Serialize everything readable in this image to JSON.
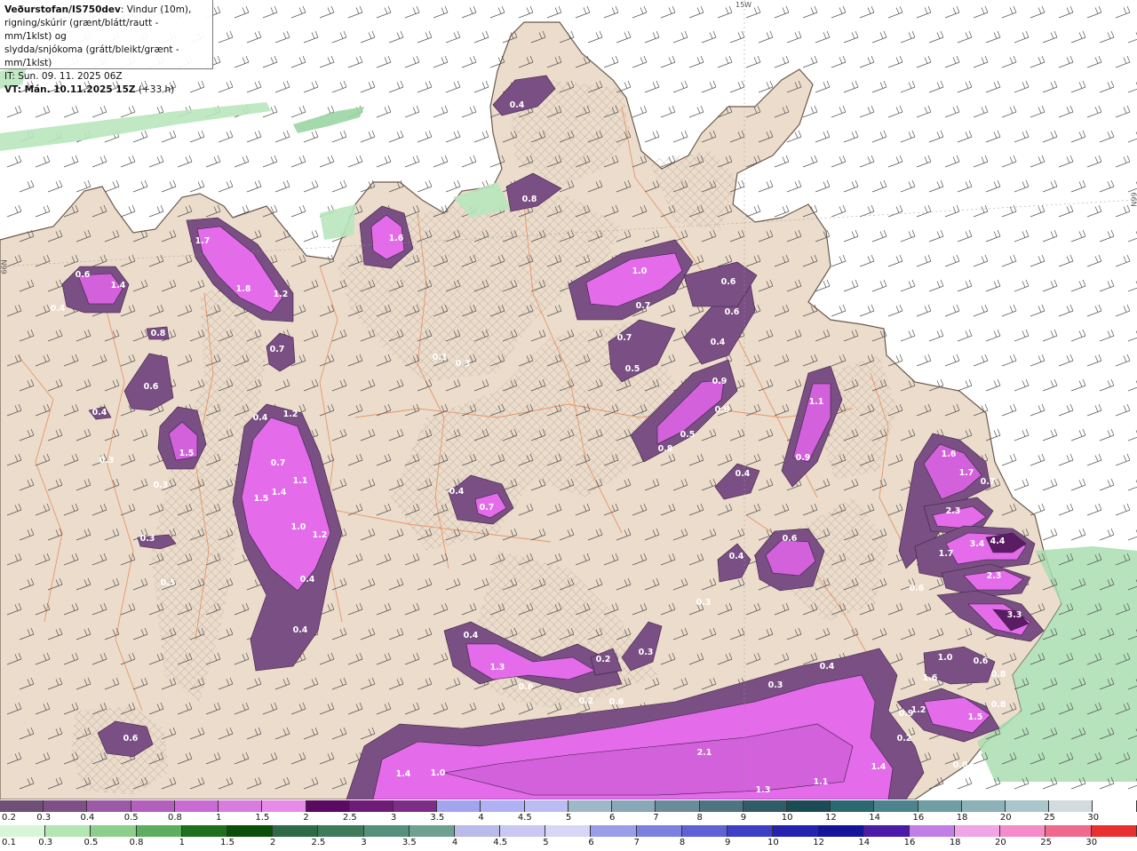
{
  "title": {
    "line1_bold": "Veðurstofan/IS750dev",
    "line1_rest": ": Vindur (10m),",
    "line2": "rigning/skúrir (grænt/blátt/rautt - mm/1klst) og",
    "line3": "slydda/snjókoma (grátt/bleikt/grænt - mm/1klst)",
    "line4": "IT: Sun. 09. 11. 2025 06Z",
    "line5_bold": "VT: Mán. 10.11.2025 15Z",
    "line5_rest": " (+33 h)"
  },
  "graticule": {
    "lon_label": "15W",
    "lat_label_right": "66N",
    "lat_label_left": "66N"
  },
  "legend_snow": {
    "levels": [
      "0.2",
      "0.3",
      "0.4",
      "0.5",
      "0.8",
      "1",
      "1.5",
      "2",
      "2.5",
      "3",
      "3.5",
      "4",
      "4.5",
      "5",
      "6",
      "7",
      "8",
      "9",
      "10",
      "12",
      "14",
      "16",
      "18",
      "20",
      "25",
      "30"
    ],
    "colors": [
      "#6e4f75",
      "#7f4f87",
      "#9b5aa6",
      "#b35fbd",
      "#c86bd2",
      "#d97ce0",
      "#e88ae8",
      "#5a0a63",
      "#6f1c77",
      "#7d2d86",
      "#a4a4ee",
      "#b0b0f4",
      "#bcbcf4",
      "#9fb8c8",
      "#88a8b5",
      "#6a8c99",
      "#4e7480",
      "#2f5c66",
      "#1b4c55",
      "#2c6870",
      "#4b848c",
      "#6f9ea5",
      "#8cb2b8",
      "#a9c6ca",
      "#d2dcde",
      "#ffffff"
    ]
  },
  "legend_rain": {
    "levels": [
      "0.1",
      "0.3",
      "0.5",
      "0.8",
      "1",
      "1.5",
      "2",
      "2.5",
      "3",
      "3.5",
      "4",
      "4.5",
      "5",
      "6",
      "7",
      "8",
      "9",
      "10",
      "12",
      "14",
      "16",
      "18",
      "20",
      "25",
      "30"
    ],
    "colors": [
      "#d9f5d9",
      "#b4e6b4",
      "#8ccf8c",
      "#5fae5f",
      "#1f6f1f",
      "#0b4f0b",
      "#2d6a45",
      "#3f7b5a",
      "#55907a",
      "#6fa092",
      "#b9bbe8",
      "#c8c8f2",
      "#d6d6f7",
      "#9a9ee8",
      "#7c80de",
      "#5e62d4",
      "#3d40c4",
      "#2323b0",
      "#141499",
      "#4b1caa",
      "#c17fe6",
      "#f0a5e6",
      "#f48cc8",
      "#f06a8e",
      "#e83030"
    ]
  },
  "precip_values": [
    {
      "v": "0.4"
    },
    {
      "v": "0.8"
    },
    {
      "v": "1.6"
    },
    {
      "v": "1.7"
    },
    {
      "v": "1.8"
    },
    {
      "v": "1.2"
    },
    {
      "v": "0.6"
    },
    {
      "v": "1.4"
    },
    {
      "v": "0.4"
    },
    {
      "v": "0.8"
    },
    {
      "v": "0.7"
    },
    {
      "v": "0.6"
    },
    {
      "v": "0.4"
    },
    {
      "v": "1.5"
    },
    {
      "v": "0.3"
    },
    {
      "v": "0.3"
    },
    {
      "v": "0.3"
    },
    {
      "v": "0.5"
    },
    {
      "v": "0.4"
    },
    {
      "v": "1.2"
    },
    {
      "v": "0.7"
    },
    {
      "v": "1.4"
    },
    {
      "v": "1.1"
    },
    {
      "v": "1.5"
    },
    {
      "v": "1.0"
    },
    {
      "v": "1.2"
    },
    {
      "v": "0.4"
    },
    {
      "v": "0.4"
    },
    {
      "v": "0.3"
    },
    {
      "v": "0.3"
    },
    {
      "v": "0.4"
    },
    {
      "v": "0.7"
    },
    {
      "v": "1.0"
    },
    {
      "v": "0.7"
    },
    {
      "v": "0.6"
    },
    {
      "v": "0.6"
    },
    {
      "v": "0.7"
    },
    {
      "v": "0.5"
    },
    {
      "v": "0.4"
    },
    {
      "v": "0.9"
    },
    {
      "v": "0.8"
    },
    {
      "v": "0.8"
    },
    {
      "v": "0.5"
    },
    {
      "v": "1.1"
    },
    {
      "v": "0.9"
    },
    {
      "v": "0.4"
    },
    {
      "v": "0.6"
    },
    {
      "v": "0.4"
    },
    {
      "v": "0.3"
    },
    {
      "v": "1.6"
    },
    {
      "v": "1.7"
    },
    {
      "v": "0.7"
    },
    {
      "v": "2.3"
    },
    {
      "v": "3.4"
    },
    {
      "v": "4.4"
    },
    {
      "v": "1.7"
    },
    {
      "v": "2.3"
    },
    {
      "v": "0.6"
    },
    {
      "v": "3.3"
    },
    {
      "v": "0.4"
    },
    {
      "v": "1.3"
    },
    {
      "v": "0.6"
    },
    {
      "v": "0.2"
    },
    {
      "v": "0.3"
    },
    {
      "v": "0.4"
    },
    {
      "v": "0.3"
    },
    {
      "v": "0.6"
    },
    {
      "v": "1.0"
    },
    {
      "v": "0.6"
    },
    {
      "v": "1.6"
    },
    {
      "v": "0.8"
    },
    {
      "v": "1.2"
    },
    {
      "v": "1.5"
    },
    {
      "v": "0.6"
    },
    {
      "v": "0.9"
    },
    {
      "v": "0.8"
    },
    {
      "v": "0.2"
    },
    {
      "v": "2.1"
    },
    {
      "v": "1.4"
    },
    {
      "v": "1.0"
    },
    {
      "v": "1.3"
    },
    {
      "v": "1.1"
    },
    {
      "v": "1.4"
    },
    {
      "v": "0.6"
    },
    {
      "v": "0.2"
    }
  ]
}
